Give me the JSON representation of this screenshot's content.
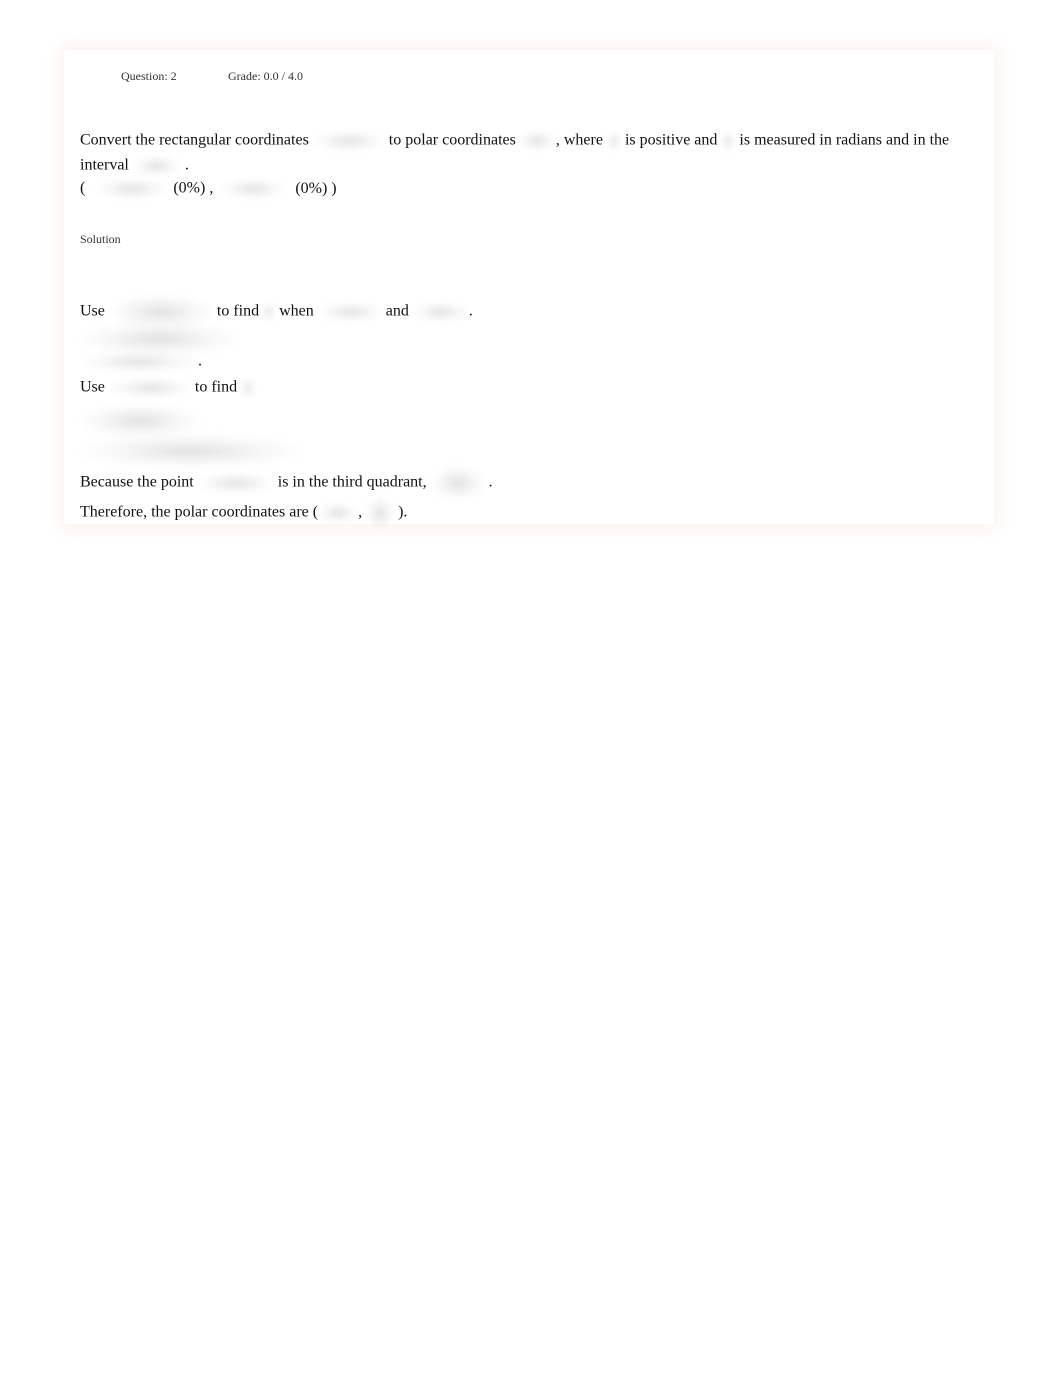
{
  "header": {
    "question_label": "Question: 2",
    "grade_label": "Grade: 0.0 / 4.0"
  },
  "question": {
    "part1": "Convert the rectangular coordinates",
    "part2": "to polar coordinates",
    "part3": ", where",
    "part4": "is positive and",
    "part5": "is measured in radians and in the",
    "part6": "interval",
    "part7": ".",
    "answer_open": "(",
    "answer1_score": "(0%) ,",
    "answer2_score": "(0%) )"
  },
  "solution": {
    "label": "Solution",
    "s1_use": "Use",
    "s1_tofind": "to find",
    "s1_when": "when",
    "s1_and": "and",
    "s1_end": ".",
    "s2_end": ".",
    "s3_use": "Use",
    "s3_tofind": "to find",
    "s4_because": "Because the point",
    "s4_quadrant": "is in the third quadrant,",
    "s4_end": ".",
    "s5_therefore": "Therefore, the polar coordinates are (",
    "s5_comma": ",",
    "s5_end": ")."
  }
}
